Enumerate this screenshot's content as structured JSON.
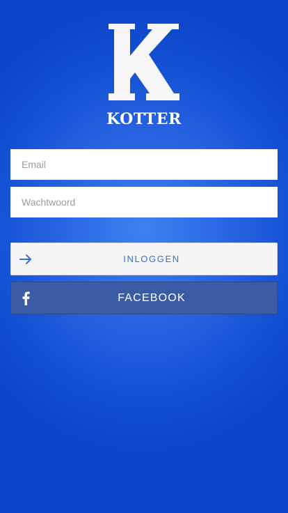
{
  "brand": {
    "name": "KOTTER",
    "logo_icon": "kotter-k-logo-icon"
  },
  "login_form": {
    "email_placeholder": "Email",
    "password_placeholder": "Wachtwoord"
  },
  "buttons": {
    "login_label": "INLOGGEN",
    "login_icon": "arrow-right-icon",
    "facebook_label": "FACEBOOK",
    "facebook_icon": "facebook-icon"
  },
  "colors": {
    "background_blue": "#1450d4",
    "login_text": "#2f6fdb",
    "facebook_blue": "#3b5ba5"
  }
}
